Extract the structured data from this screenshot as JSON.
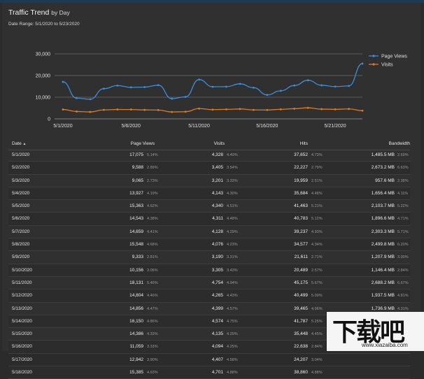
{
  "header": {
    "title": "Traffic Trend",
    "title_suffix": "by Day",
    "date_range": "Date Range: 5/1/2020 to 5/23/2020"
  },
  "chart_data": {
    "type": "line",
    "x": [
      "5/1",
      "5/2",
      "5/3",
      "5/4",
      "5/5",
      "5/6",
      "5/7",
      "5/8",
      "5/9",
      "5/10",
      "5/11",
      "5/12",
      "5/13",
      "5/14",
      "5/15",
      "5/16",
      "5/17",
      "5/18",
      "5/19",
      "5/20",
      "5/21",
      "5/22",
      "5/23"
    ],
    "x_tick_labels": [
      "5/1/2020",
      "5/6/2020",
      "5/11/2020",
      "5/16/2020",
      "5/21/2020"
    ],
    "y_tick_labels": [
      "30,000",
      "20,000",
      "10,000",
      "0"
    ],
    "ylim": [
      0,
      30000
    ],
    "grid": true,
    "legend_position": "top-right",
    "series": [
      {
        "name": "Page Views",
        "color": "#3b8ed8",
        "values": [
          17075,
          9588,
          9065,
          13927,
          15363,
          14543,
          14659,
          15548,
          9333,
          10156,
          18131,
          14804,
          14856,
          16150,
          14386,
          11059,
          12942,
          15385,
          17800,
          15500,
          14900,
          15200,
          25500
        ]
      },
      {
        "name": "Visits",
        "color": "#e07a1f",
        "values": [
          4328,
          3405,
          3201,
          4143,
          4340,
          4311,
          4128,
          4076,
          3190,
          3305,
          4754,
          4265,
          4399,
          4574,
          4135,
          4094,
          4407,
          4701,
          5100,
          4500,
          4400,
          4600,
          3800
        ]
      }
    ]
  },
  "table": {
    "columns": [
      "Date",
      "Page Views",
      "Visits",
      "Hits",
      "Bandwidth"
    ],
    "sort_indicator": "▲",
    "rows": [
      {
        "date": "5/1/2020",
        "pv": "17,075",
        "pv_pct": "5.14%",
        "visits": "4,328",
        "v_pct": "4.49%",
        "hits": "37,652",
        "h_pct": "4.73%",
        "bw": "1,485.5 MB",
        "bw_pct": "2.69%"
      },
      {
        "date": "5/2/2020",
        "pv": "9,588",
        "pv_pct": "2.89%",
        "visits": "3,405",
        "v_pct": "3.54%",
        "hits": "22,227",
        "h_pct": "2.79%",
        "bw": "2,673.2 MB",
        "bw_pct": "6.63%"
      },
      {
        "date": "5/3/2020",
        "pv": "9,065",
        "pv_pct": "2.73%",
        "visits": "3,201",
        "v_pct": "3.33%",
        "hits": "19,959",
        "h_pct": "2.51%",
        "bw": "957.6 MB",
        "bw_pct": "2.38%"
      },
      {
        "date": "5/4/2020",
        "pv": "13,927",
        "pv_pct": "4.19%",
        "visits": "4,143",
        "v_pct": "4.30%",
        "hits": "35,684",
        "h_pct": "4.48%",
        "bw": "1,656.4 MB",
        "bw_pct": "4.11%"
      },
      {
        "date": "5/5/2020",
        "pv": "15,363",
        "pv_pct": "4.62%",
        "visits": "4,340",
        "v_pct": "4.51%",
        "hits": "41,463",
        "h_pct": "5.21%",
        "bw": "2,103.7 MB",
        "bw_pct": "5.22%"
      },
      {
        "date": "5/6/2020",
        "pv": "14,543",
        "pv_pct": "4.38%",
        "visits": "4,311",
        "v_pct": "4.48%",
        "hits": "40,783",
        "h_pct": "5.12%",
        "bw": "1,896.6 MB",
        "bw_pct": "4.71%"
      },
      {
        "date": "5/7/2020",
        "pv": "14,659",
        "pv_pct": "4.41%",
        "visits": "4,128",
        "v_pct": "4.29%",
        "hits": "39,237",
        "h_pct": "4.93%",
        "bw": "2,303.3 MB",
        "bw_pct": "5.71%"
      },
      {
        "date": "5/8/2020",
        "pv": "15,548",
        "pv_pct": "4.68%",
        "visits": "4,076",
        "v_pct": "4.23%",
        "hits": "34,577",
        "h_pct": "4.34%",
        "bw": "2,499.8 MB",
        "bw_pct": "6.20%"
      },
      {
        "date": "5/9/2020",
        "pv": "9,333",
        "pv_pct": "2.81%",
        "visits": "3,190",
        "v_pct": "3.31%",
        "hits": "21,611",
        "h_pct": "2.71%",
        "bw": "1,207.9 MB",
        "bw_pct": "3.00%"
      },
      {
        "date": "5/10/2020",
        "pv": "10,156",
        "pv_pct": "3.06%",
        "visits": "3,305",
        "v_pct": "3.43%",
        "hits": "20,489",
        "h_pct": "2.57%",
        "bw": "1,146.4 MB",
        "bw_pct": "2.84%"
      },
      {
        "date": "5/11/2020",
        "pv": "18,131",
        "pv_pct": "5.46%",
        "visits": "4,754",
        "v_pct": "4.94%",
        "hits": "45,175",
        "h_pct": "5.67%",
        "bw": "2,688.2 MB",
        "bw_pct": "6.67%"
      },
      {
        "date": "5/12/2020",
        "pv": "14,804",
        "pv_pct": "4.46%",
        "visits": "4,265",
        "v_pct": "4.43%",
        "hits": "40,499",
        "h_pct": "5.09%",
        "bw": "1,937.5 MB",
        "bw_pct": "4.81%"
      },
      {
        "date": "5/13/2020",
        "pv": "14,856",
        "pv_pct": "4.47%",
        "visits": "4,399",
        "v_pct": "4.57%",
        "hits": "39,465",
        "h_pct": "4.96%",
        "bw": "1,736.9 MB",
        "bw_pct": "4.31%"
      },
      {
        "date": "5/14/2020",
        "pv": "16,150",
        "pv_pct": "4.86%",
        "visits": "4,574",
        "v_pct": "4.75%",
        "hits": "41,787",
        "h_pct": "5.25%",
        "bw": "2,601.3 MB",
        "bw_pct": "6.45%"
      },
      {
        "date": "5/15/2020",
        "pv": "14,386",
        "pv_pct": "4.33%",
        "visits": "4,135",
        "v_pct": "4.29%",
        "hits": "35,448",
        "h_pct": "4.45%",
        "bw": "",
        "bw_pct": ""
      },
      {
        "date": "5/16/2020",
        "pv": "11,059",
        "pv_pct": "3.33%",
        "visits": "4,094",
        "v_pct": "4.25%",
        "hits": "22,638",
        "h_pct": "2.84%",
        "bw": "",
        "bw_pct": ""
      },
      {
        "date": "5/17/2020",
        "pv": "12,942",
        "pv_pct": "3.90%",
        "visits": "4,407",
        "v_pct": "4.58%",
        "hits": "24,207",
        "h_pct": "3.04%",
        "bw": "",
        "bw_pct": ""
      },
      {
        "date": "5/18/2020",
        "pv": "15,385",
        "pv_pct": "4.63%",
        "visits": "4,701",
        "v_pct": "4.88%",
        "hits": "38,860",
        "h_pct": "4.88%",
        "bw": "",
        "bw_pct": ""
      }
    ]
  },
  "watermark": {
    "logo": "下载吧",
    "url": "www.xiazaiba.com"
  }
}
